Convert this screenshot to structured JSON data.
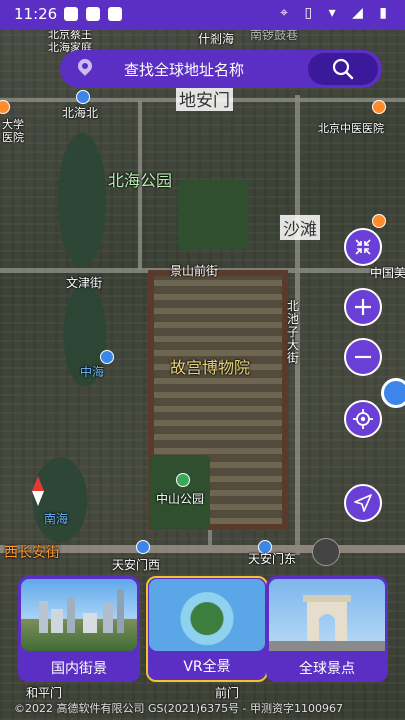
{
  "status_bar": {
    "time": "11:26",
    "icons": [
      "location-icon",
      "vibrate-icon",
      "wifi-icon",
      "signal-icon",
      "battery-icon"
    ]
  },
  "search": {
    "placeholder": "查找全球地址名称",
    "icon": "search-icon",
    "pin_icon": "location-pin-icon"
  },
  "map_labels": {
    "top_left": "北京蔡王\n北海家庭",
    "top_mid": "什剎海",
    "top_right_faded": "南锣鼓巷",
    "dianmen": "地安门",
    "beihaibei": "北海北",
    "daxue": "大学\n医院",
    "zhongyi": "北京中医医院",
    "beihai_park": "北海公园",
    "shatan": "沙滩",
    "wenjin": "文津街",
    "jingshan": "景山前街",
    "zhongguomei": "中国美",
    "beichizi": "北\n池\n子\n大\n街",
    "zhonghai": "中海",
    "palace": "故宫博物院",
    "nanhai": "南海",
    "zhongshan": "中山公园",
    "xichangan": "西长安街",
    "tiananmen_west": "天安门西",
    "tiananmen_east": "天安门东",
    "heping": "和平门",
    "qianmen": "前门"
  },
  "controls": {
    "collapse": "collapse-arrows-icon",
    "zoom_in": "plus-icon",
    "zoom_out": "minus-icon",
    "locate": "crosshair-icon",
    "navigate": "navigation-arrow-icon"
  },
  "cards": [
    {
      "label": "国内街景",
      "icon": "city-skyline-image"
    },
    {
      "label": "VR全景",
      "icon": "vr-globe-image"
    },
    {
      "label": "全球景点",
      "icon": "arc-de-triomphe-image"
    }
  ],
  "copyright": "©2022 高德软件有限公司 GS(2021)6375号 - 甲测资字1100967",
  "colors": {
    "accent": "#5b2fc4",
    "accent_dark": "#3a1a9a",
    "active_border": "#f3c22e"
  }
}
